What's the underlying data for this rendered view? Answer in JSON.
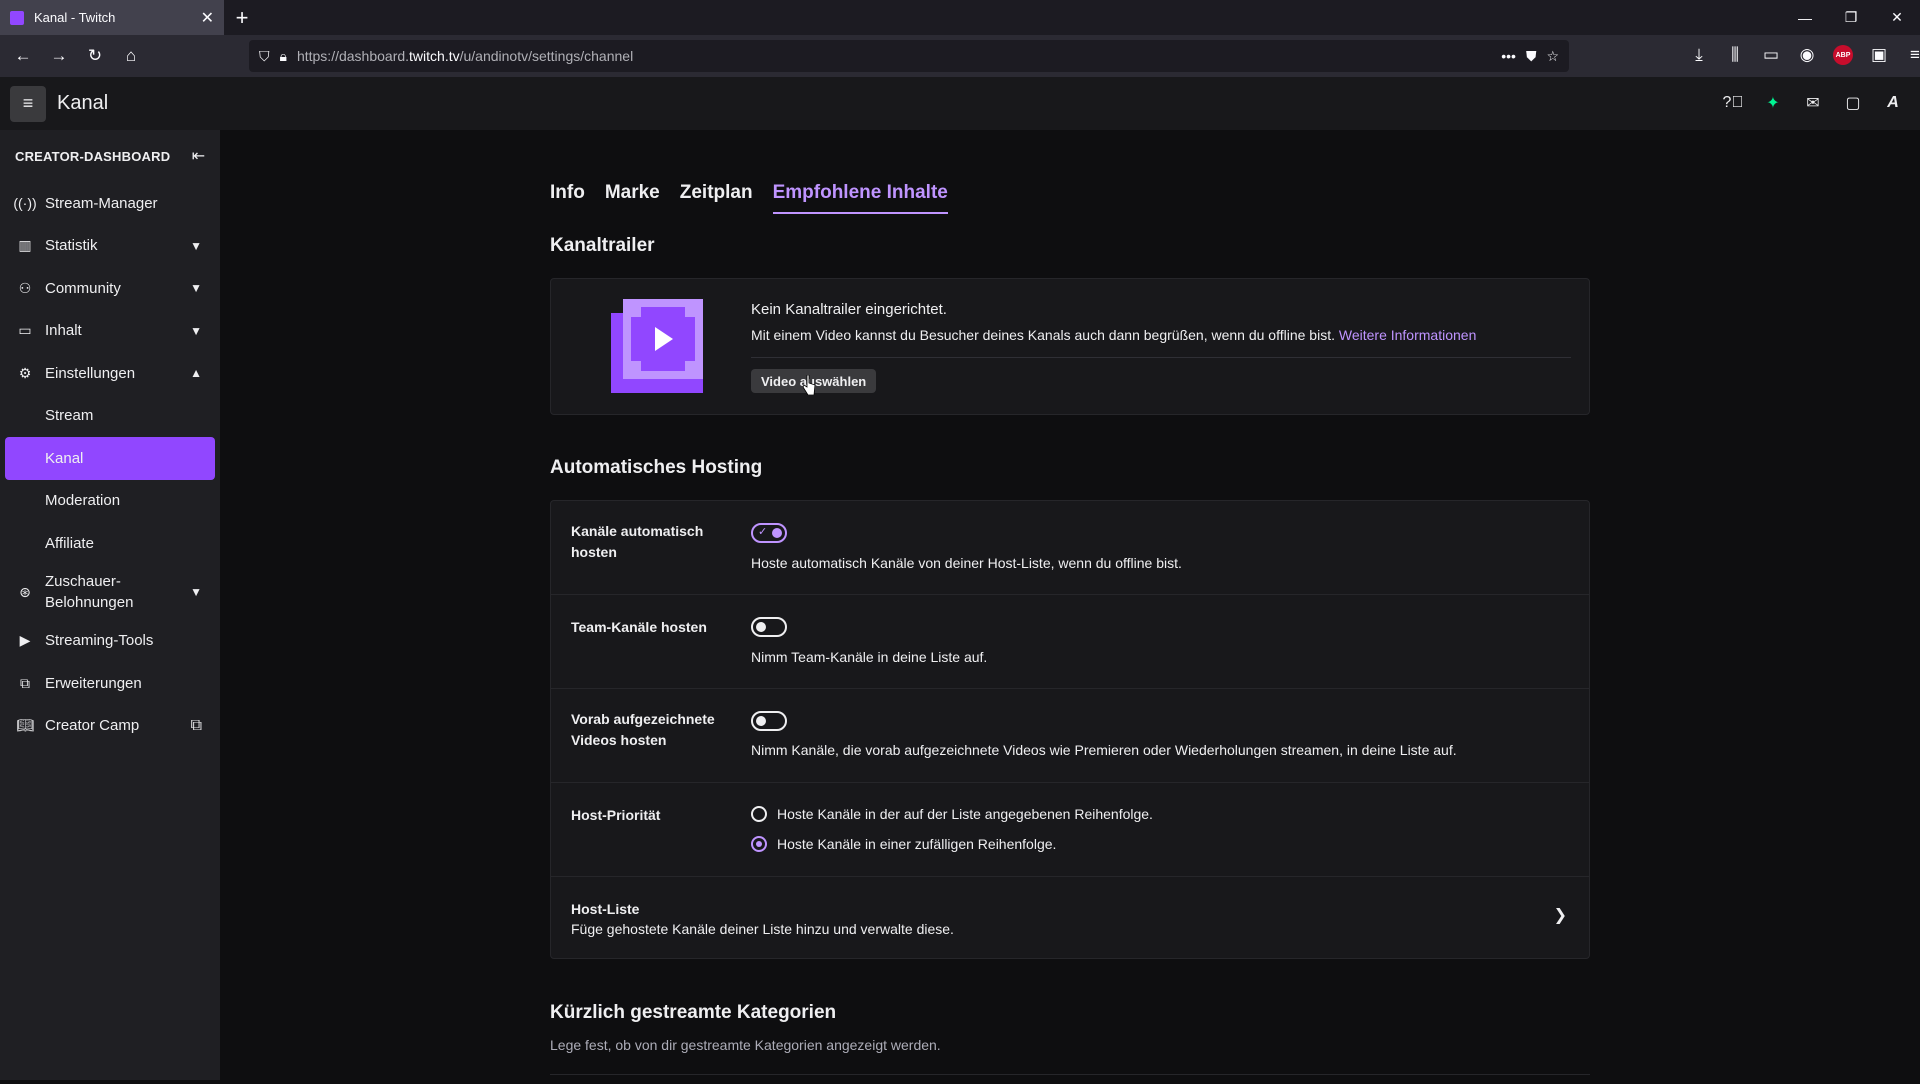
{
  "browser": {
    "tab_title": "Kanal - Twitch",
    "new_tab": "+",
    "url_prefix": "https://dashboard.",
    "url_domain": "twitch.tv",
    "url_path": "/u/andinotv/settings/channel",
    "abp_badge": "ABP"
  },
  "topbar": {
    "title": "Kanal"
  },
  "sidebar": {
    "header": "CREATOR-DASHBOARD",
    "items": [
      {
        "label": "Stream-Manager",
        "icon": "broadcast-icon"
      },
      {
        "label": "Statistik",
        "icon": "stats-icon"
      },
      {
        "label": "Community",
        "icon": "community-icon"
      },
      {
        "label": "Inhalt",
        "icon": "content-icon"
      },
      {
        "label": "Einstellungen",
        "icon": "settings-icon"
      },
      {
        "label": "Stream"
      },
      {
        "label": "Kanal"
      },
      {
        "label": "Moderation"
      },
      {
        "label": "Affiliate"
      },
      {
        "label": "Zuschauer-\nBelohnungen",
        "icon": "rewards-icon"
      },
      {
        "label": "Streaming-Tools",
        "icon": "camera-icon"
      },
      {
        "label": "Erweiterungen",
        "icon": "extensions-icon"
      },
      {
        "label": "Creator Camp",
        "icon": "book-icon"
      }
    ]
  },
  "main": {
    "tabs": [
      "Info",
      "Marke",
      "Zeitplan",
      "Empfohlene Inhalte"
    ],
    "trailer": {
      "title": "Kanaltrailer",
      "line1": "Kein Kanaltrailer eingerichtet.",
      "line2": "Mit einem Video kannst du Besucher deines Kanals auch dann begrüßen, wenn du offline bist.",
      "link": "Weitere Informationen",
      "button": "Video auswählen"
    },
    "hosting": {
      "title": "Automatisches Hosting",
      "auto_label": "Kanäle automatisch hosten",
      "auto_desc": "Hoste automatisch Kanäle von deiner Host-Liste, wenn du offline bist.",
      "team_label": "Team-Kanäle hosten",
      "team_desc": "Nimm Team-Kanäle in deine Liste auf.",
      "vod_label": "Vorab aufgezeichnete Videos hosten",
      "vod_desc": "Nimm Kanäle, die vorab aufgezeichnete Videos wie Premieren oder Wiederholungen streamen, in deine Liste auf.",
      "priority_label": "Host-Priorität",
      "priority_opt1": "Hoste Kanäle in der auf der Liste angegebenen Reihenfolge.",
      "priority_opt2": "Hoste Kanäle in einer zufälligen Reihenfolge.",
      "list_label": "Host-Liste",
      "list_desc": "Füge gehostete Kanäle deiner Liste hinzu und verwalte diese."
    },
    "categories": {
      "title": "Kürzlich gestreamte Kategorien",
      "desc": "Lege fest, ob von dir gestreamte Kategorien angezeigt werden."
    }
  },
  "colors": {
    "accent": "#9147ff",
    "accent_light": "#bf94ff",
    "bg": "#0e0e10"
  }
}
